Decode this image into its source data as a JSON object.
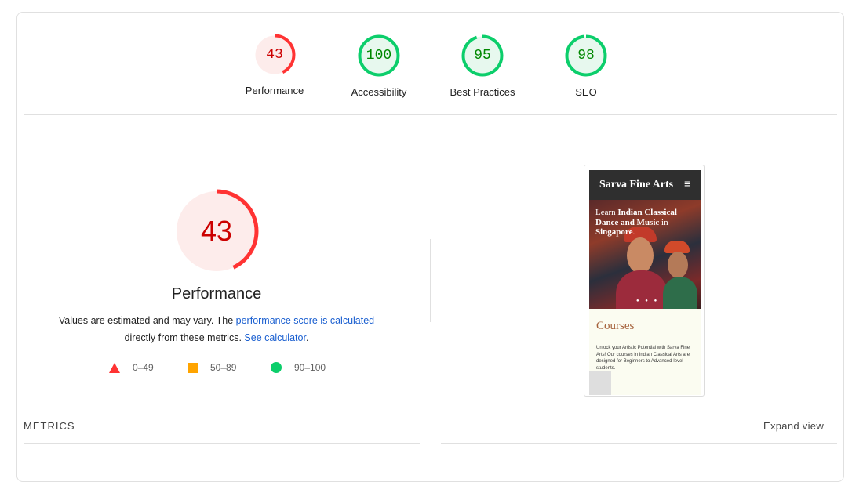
{
  "summary_gauges": [
    {
      "score": "43",
      "label": "Performance",
      "fraction": 0.43,
      "color": "#ff3333",
      "text_color": "#c00",
      "fill": "#fdeceb"
    },
    {
      "score": "100",
      "label": "Accessibility",
      "fraction": 1.0,
      "color": "#0cce6b",
      "text_color": "#080",
      "fill": "#e7f8ee"
    },
    {
      "score": "95",
      "label": "Best Practices",
      "fraction": 0.95,
      "color": "#0cce6b",
      "text_color": "#080",
      "fill": "#e7f8ee"
    },
    {
      "score": "98",
      "label": "SEO",
      "fraction": 0.98,
      "color": "#0cce6b",
      "text_color": "#080",
      "fill": "#e7f8ee"
    }
  ],
  "performance": {
    "score": "43",
    "fraction": 0.43,
    "title": "Performance",
    "desc_part1": "Values are estimated and may vary. The ",
    "link_score": "performance score is calculated",
    "desc_part2": " directly from these metrics. ",
    "link_calc": "See calculator",
    "desc_end": "."
  },
  "legend": [
    {
      "range": "0–49",
      "shape": "triangle",
      "color": "#ff3333"
    },
    {
      "range": "50–89",
      "shape": "square",
      "color": "#ffa400"
    },
    {
      "range": "90–100",
      "shape": "circle",
      "color": "#0cce6b"
    }
  ],
  "screenshot": {
    "site_title": "Sarva Fine Arts",
    "menu_icon": "≡",
    "hero_pre": "Learn ",
    "hero_bold": "Indian Classical Dance and Music",
    "hero_post": " in ",
    "hero_place": "Singapore",
    "hero_end": ".",
    "section_title": "Courses",
    "section_text": "Unlock your Artistic Potential with Sarva Fine Arts! Our courses in Indian Classical Arts are designed for Beginners to Advanced-level students."
  },
  "metrics_label": "METRICS",
  "expand_label": "Expand view"
}
